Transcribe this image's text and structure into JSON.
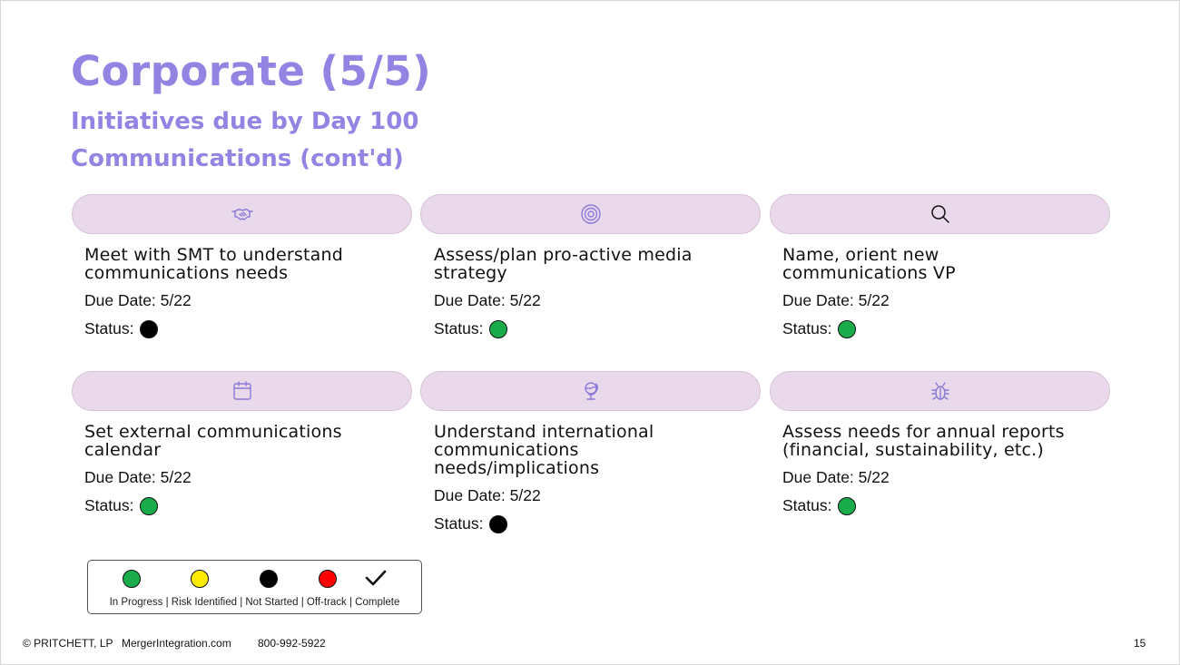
{
  "slide": {
    "title": "Corporate (5/5)",
    "subtitle1": "Initiatives due by Day 100",
    "subtitle2": "Communications (cont'd)",
    "status_label": "Status:",
    "colors": {
      "accent": "#9384e3",
      "header_bg": "#ead9ea",
      "in_progress": "#1aab4b",
      "risk_identified": "#ffeb00",
      "not_started": "#000000",
      "off_track": "#ff0000"
    }
  },
  "cards": [
    {
      "icon": "handshake-icon",
      "title": "Meet with SMT to understand communications needs",
      "due": "Due Date: 5/22",
      "status": "Not Started"
    },
    {
      "icon": "target-icon",
      "title": "Assess/plan pro-active media strategy",
      "due": "Due Date: 5/22",
      "status": "In Progress"
    },
    {
      "icon": "search-icon",
      "title": "Name, orient new communications VP",
      "due": "Due Date: 5/22",
      "status": "In Progress"
    },
    {
      "icon": "calendar-icon",
      "title": "Set external communications calendar",
      "due": "Due Date: 5/22",
      "status": "In Progress"
    },
    {
      "icon": "globe-icon",
      "title": "Understand international communications needs/implications",
      "due": "Due Date: 5/22",
      "status": "Not Started"
    },
    {
      "icon": "bug-icon",
      "title": "Assess needs for annual reports (financial, sustainability, etc.)",
      "due": "Due Date: 5/22",
      "status": "In Progress"
    }
  ],
  "legend": {
    "labels": "In Progress | Risk Identified  | Not Started | Off-track | Complete",
    "items": [
      "In Progress",
      "Risk Identified",
      "Not Started",
      "Off-track",
      "Complete"
    ]
  },
  "footer": {
    "copyright": "© PRITCHETT, LP",
    "website": "MergerIntegration.com",
    "phone": "800-992-5922",
    "page_number": "15"
  }
}
